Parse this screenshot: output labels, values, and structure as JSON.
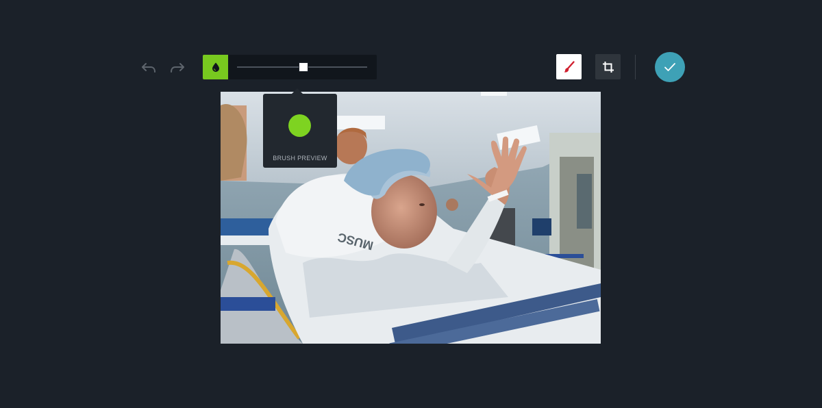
{
  "toolbar": {
    "undo_icon": "undo-arrow-icon",
    "redo_icon": "redo-arrow-icon",
    "brush_opacity_icon": "water-drop-icon",
    "brush_size_fraction": 0.51,
    "paint_icon": "brush-icon",
    "crop_icon": "crop-icon",
    "confirm_icon": "checkmark-icon"
  },
  "brush_preview": {
    "label": "BRUSH PREVIEW",
    "color": "#7ed321"
  },
  "photo": {
    "cap_text": "MUSC"
  },
  "colors": {
    "background": "#1b2129",
    "accent_green": "#78c91f",
    "confirm_teal": "#3ea1b6",
    "paint_red": "#d0202f"
  }
}
